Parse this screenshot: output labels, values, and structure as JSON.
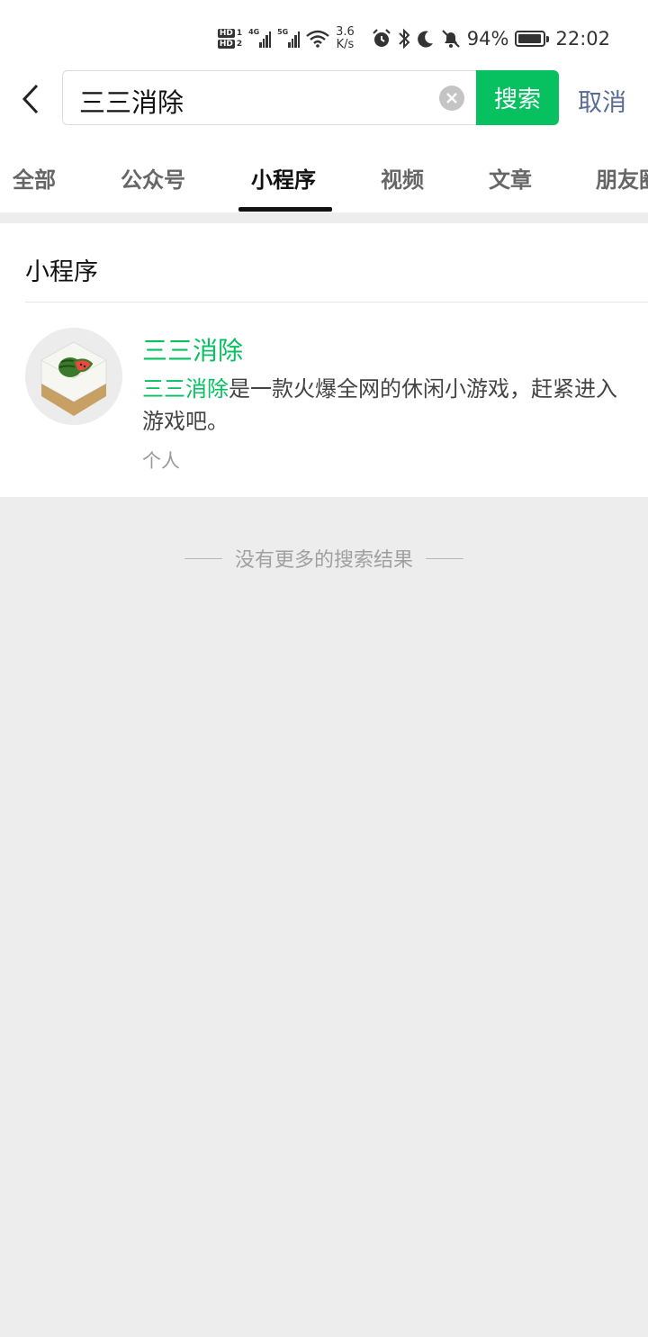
{
  "status_bar": {
    "hd1": "HD",
    "hd1_sim": "1",
    "hd2": "HD",
    "hd2_sim": "2",
    "net1": "4G",
    "net2": "5G",
    "speed_value": "3.6",
    "speed_unit": "K/s",
    "battery": "94%",
    "battery_level": 0.94,
    "time": "22:02"
  },
  "search": {
    "query": "三三消除",
    "search_button": "搜索",
    "cancel_button": "取消"
  },
  "tabs": [
    {
      "label": "全部"
    },
    {
      "label": "公众号"
    },
    {
      "label": "小程序",
      "active": true
    },
    {
      "label": "视频"
    },
    {
      "label": "文章"
    },
    {
      "label": "朋友圈"
    }
  ],
  "section": {
    "title": "小程序"
  },
  "result": {
    "title": "三三消除",
    "desc_highlight": "三三消除",
    "desc_rest": "是一款火爆全网的休闲小游戏，赶紧进入游戏吧。",
    "type": "个人"
  },
  "footer": {
    "no_more": "没有更多的搜索结果"
  },
  "colors": {
    "accent": "#07c160",
    "link": "#576b95",
    "page_bg": "#ededed"
  },
  "icons": [
    "back-arrow-icon",
    "clear-icon",
    "alarm-icon",
    "bluetooth-icon",
    "moon-icon",
    "mute-bell-icon",
    "wifi-icon",
    "battery-icon",
    "watermelon-tile-icon"
  ]
}
